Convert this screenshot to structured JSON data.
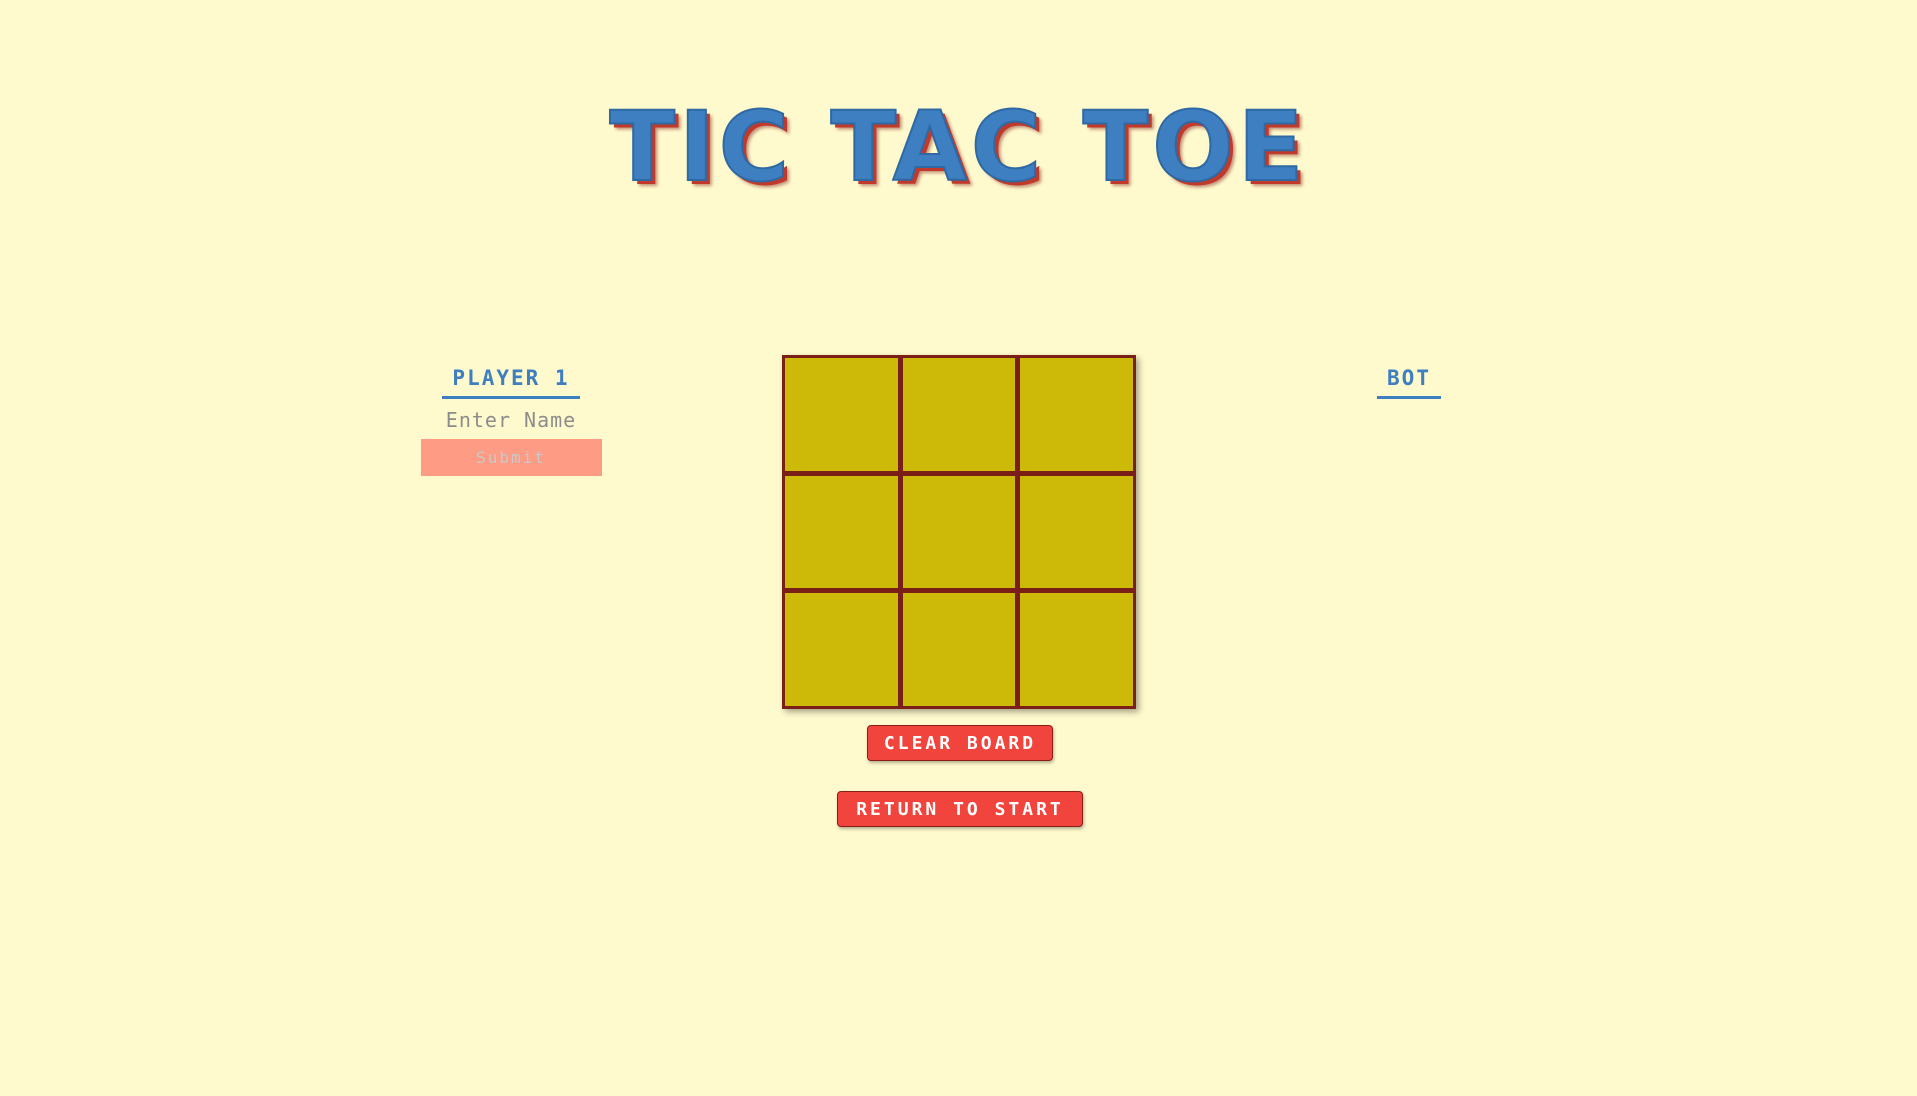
{
  "page": {
    "title": "TIC TAC TOE"
  },
  "players": {
    "player1": {
      "label": "PLAYER 1",
      "name_placeholder": "Enter Name",
      "name_value": "",
      "submit_label": "Submit"
    },
    "player2": {
      "label": "BOT"
    }
  },
  "board": {
    "cells": [
      "",
      "",
      "",
      "",
      "",
      "",
      "",
      "",
      ""
    ]
  },
  "controls": {
    "clear_label": "CLEAR BOARD",
    "return_label": "RETURN TO START"
  },
  "colors": {
    "background": "#fffacd",
    "title": "#3d7fc0",
    "title_shadow": "#c0392b",
    "board_border": "#7a1f18",
    "cell": "#cdb907",
    "button": "#f0443d",
    "submit": "#fd9b85",
    "player_label": "#3d7fc0"
  }
}
